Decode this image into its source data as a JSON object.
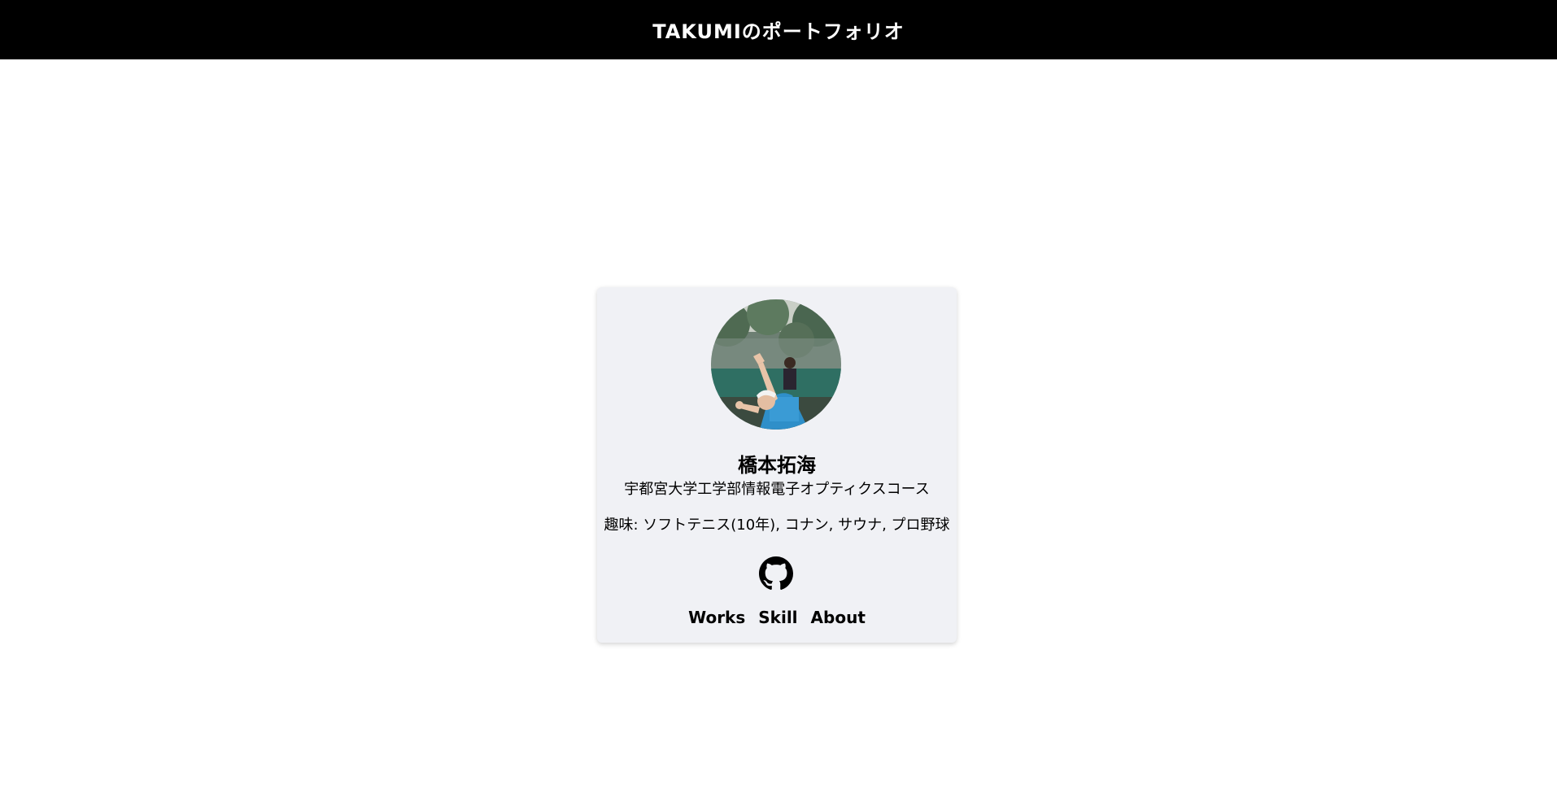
{
  "header": {
    "title": "TAKUMIのポートフォリオ"
  },
  "profile": {
    "name": "橋本拓海",
    "affiliation": "宇都宮大学工学部情報電子オプティクスコース",
    "hobbies": "趣味: ソフトテニス(10年), コナン, サウナ, プロ野球",
    "avatar_icon": "profile-photo-tennis-player",
    "github_icon": "github-icon"
  },
  "nav": {
    "items": [
      {
        "label": "Works"
      },
      {
        "label": "Skill"
      },
      {
        "label": "About"
      }
    ]
  },
  "colors": {
    "header_bg": "#000000",
    "header_text": "#ffffff",
    "card_bg": "#f0f1f5",
    "text": "#000000"
  }
}
